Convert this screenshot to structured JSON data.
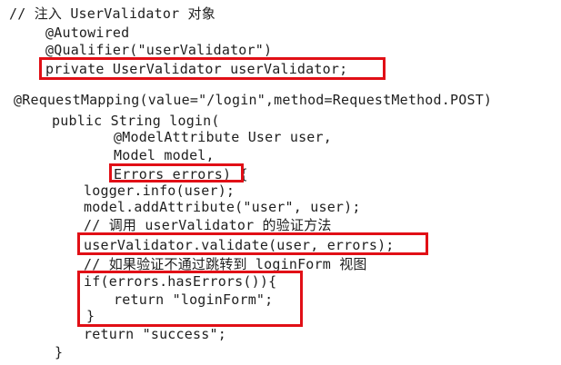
{
  "code": {
    "lines": [
      "// 注入 UserValidator 对象",
      "@Autowired",
      "@Qualifier(\"userValidator\")",
      "private UserValidator userValidator;",
      "@RequestMapping(value=\"/login\",method=RequestMethod.POST)",
      "public String login(",
      "@ModelAttribute User user,",
      "Model model,",
      "Errors errors) {",
      "logger.info(user);",
      "model.addAttribute(\"user\", user);",
      "// 调用 userValidator 的验证方法",
      "userValidator.validate(user, errors);",
      "// 如果验证不通过跳转到 loginForm 视图",
      "if(errors.hasErrors()){",
      "return \"loginForm\";",
      "}",
      "return \"success\";",
      "}"
    ]
  },
  "highlight_color": "#e10f16"
}
